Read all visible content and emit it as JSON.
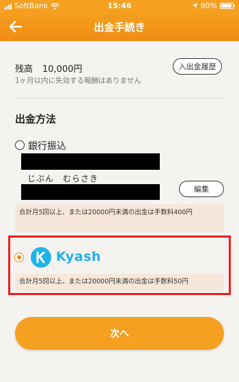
{
  "status_bar": {
    "carrier": "SoftBank",
    "time": "15:46",
    "battery": "90%"
  },
  "header": {
    "title": "出金手続き",
    "back_icon": "back-arrow-icon"
  },
  "balance": {
    "label": "残高",
    "amount": "10,000円",
    "note": "1ヶ月以内に失効する報酬はありません",
    "history_button": "入出金履歴"
  },
  "withdraw_method": {
    "title": "出金方法",
    "options": [
      {
        "label": "銀行振込",
        "selected": false,
        "account_holder": "じぶん　むらさき",
        "edit_button": "編集",
        "fee_note": "合計月5回以上、または20000円未満の出金は手数料400円"
      },
      {
        "label": "Kyash",
        "selected": true,
        "logo_icon": "kyash-logo-icon",
        "fee_note": "合計月5回以上、または20000円未満の出金は手数料50円"
      }
    ]
  },
  "next_button": "次へ",
  "colors": {
    "accent": "#f5a020",
    "kyash": "#1fb2e8",
    "highlight": "#ee1c1c",
    "note_bg": "#f6e7da"
  }
}
